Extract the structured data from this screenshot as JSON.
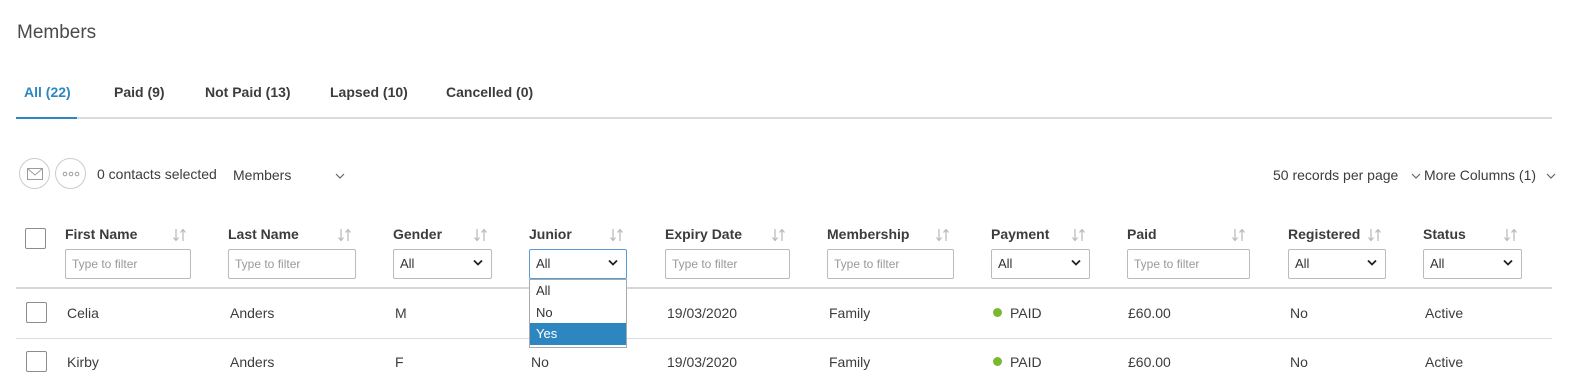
{
  "page": {
    "title": "Members"
  },
  "tabs": [
    {
      "label": "All (22)"
    },
    {
      "label": "Paid (9)"
    },
    {
      "label": "Not Paid (13)"
    },
    {
      "label": "Lapsed (10)"
    },
    {
      "label": "Cancelled (0)"
    }
  ],
  "toolbar": {
    "selected_text": "0 contacts selected",
    "view_select": "Members",
    "per_page": "50 records per page",
    "more_columns": "More Columns (1)"
  },
  "columns": {
    "first_name": "First Name",
    "last_name": "Last Name",
    "gender": "Gender",
    "junior": "Junior",
    "expiry": "Expiry Date",
    "membership": "Membership",
    "payment": "Payment",
    "paid": "Paid",
    "registered": "Registered",
    "status": "Status"
  },
  "filters": {
    "text_placeholder": "Type to filter",
    "gender": "All",
    "junior": "All",
    "payment": "All",
    "registered": "All",
    "status": "All"
  },
  "junior_dropdown": {
    "options": [
      "All",
      "No",
      "Yes"
    ],
    "highlighted": "Yes"
  },
  "rows": [
    {
      "first_name": "Celia",
      "last_name": "Anders",
      "gender": "M",
      "junior": "",
      "expiry": "19/03/2020",
      "membership": "Family",
      "payment": "PAID",
      "paid": "£60.00",
      "registered": "No",
      "status": "Active"
    },
    {
      "first_name": "Kirby",
      "last_name": "Anders",
      "gender": "F",
      "junior": "No",
      "expiry": "19/03/2020",
      "membership": "Family",
      "payment": "PAID",
      "paid": "£60.00",
      "registered": "No",
      "status": "Active"
    }
  ],
  "colors": {
    "accent": "#2e86c1",
    "paid_dot": "#7cb82f"
  }
}
